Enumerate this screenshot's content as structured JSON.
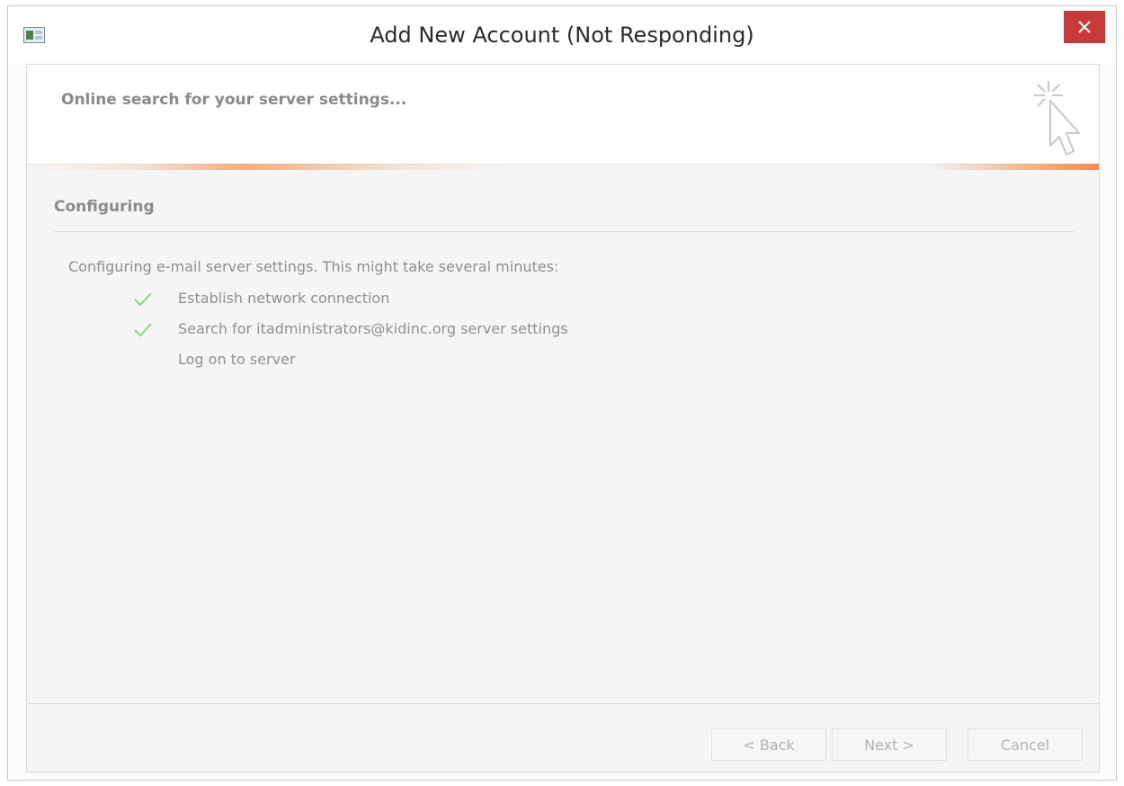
{
  "window": {
    "title": "Add New Account (Not Responding)"
  },
  "banner": {
    "heading": "Online search for your server settings..."
  },
  "section": {
    "heading": "Configuring",
    "description": "Configuring e-mail server settings. This might take several minutes:"
  },
  "tasks": [
    {
      "label": "Establish network connection",
      "status": "done",
      "icon": "check-icon"
    },
    {
      "label": "Search for itadministrators@kidinc.org server settings",
      "status": "done",
      "icon": "check-icon"
    },
    {
      "label": "Log on to server",
      "status": "pending",
      "icon": ""
    }
  ],
  "buttons": {
    "back": "< Back",
    "next": "Next >",
    "cancel": "Cancel"
  },
  "colors": {
    "close_button": "#c73a3a",
    "check": "#8fcf8f",
    "accent_glow": "#f0965a"
  }
}
